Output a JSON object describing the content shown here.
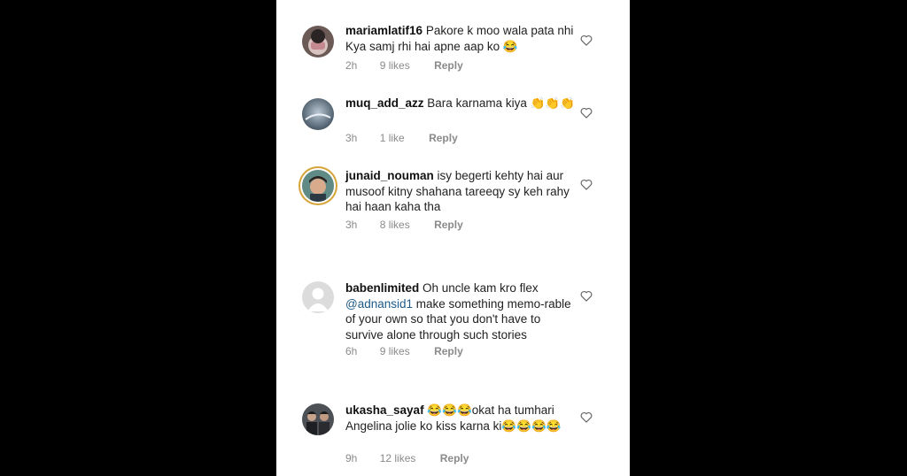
{
  "comments": [
    {
      "username": "mariamlatif16",
      "text": "Pakore k moo wala pata nhi Kya samj rhi hai apne aap ko 😂",
      "time": "2h",
      "likes": "9 likes",
      "reply": "Reply"
    },
    {
      "username": "muq_add_azz",
      "text": "Bara karnama kiya 👏👏👏",
      "time": "3h",
      "likes": "1 like",
      "reply": "Reply"
    },
    {
      "username": "junaid_nouman",
      "text": "isy begerti kehty hai aur musoof kitny shahana tareeqy sy keh rahy hai haan kaha tha",
      "time": "3h",
      "likes": "8 likes",
      "reply": "Reply"
    },
    {
      "username": "babenlimited",
      "text_pre": "Oh uncle kam kro flex",
      "mention": "@adnansid1",
      "text_post": "make something memo-rable of your own so that you don't have to survive alone through such stories",
      "time": "6h",
      "likes": "9 likes",
      "reply": "Reply"
    },
    {
      "username": "ukasha_sayaf",
      "text": "😂😂😂okat ha tumhari Angelina jolie ko kiss karna ki😂😂😂😂",
      "time": "9h",
      "likes": "12 likes",
      "reply": "Reply"
    }
  ],
  "icons": {
    "like": "heart-outline-icon",
    "avatar_placeholder": "default-avatar-icon"
  },
  "colors": {
    "mention": "#1f5a86",
    "story_ring": "#d6a53a",
    "meta": "#8a8a8a"
  }
}
